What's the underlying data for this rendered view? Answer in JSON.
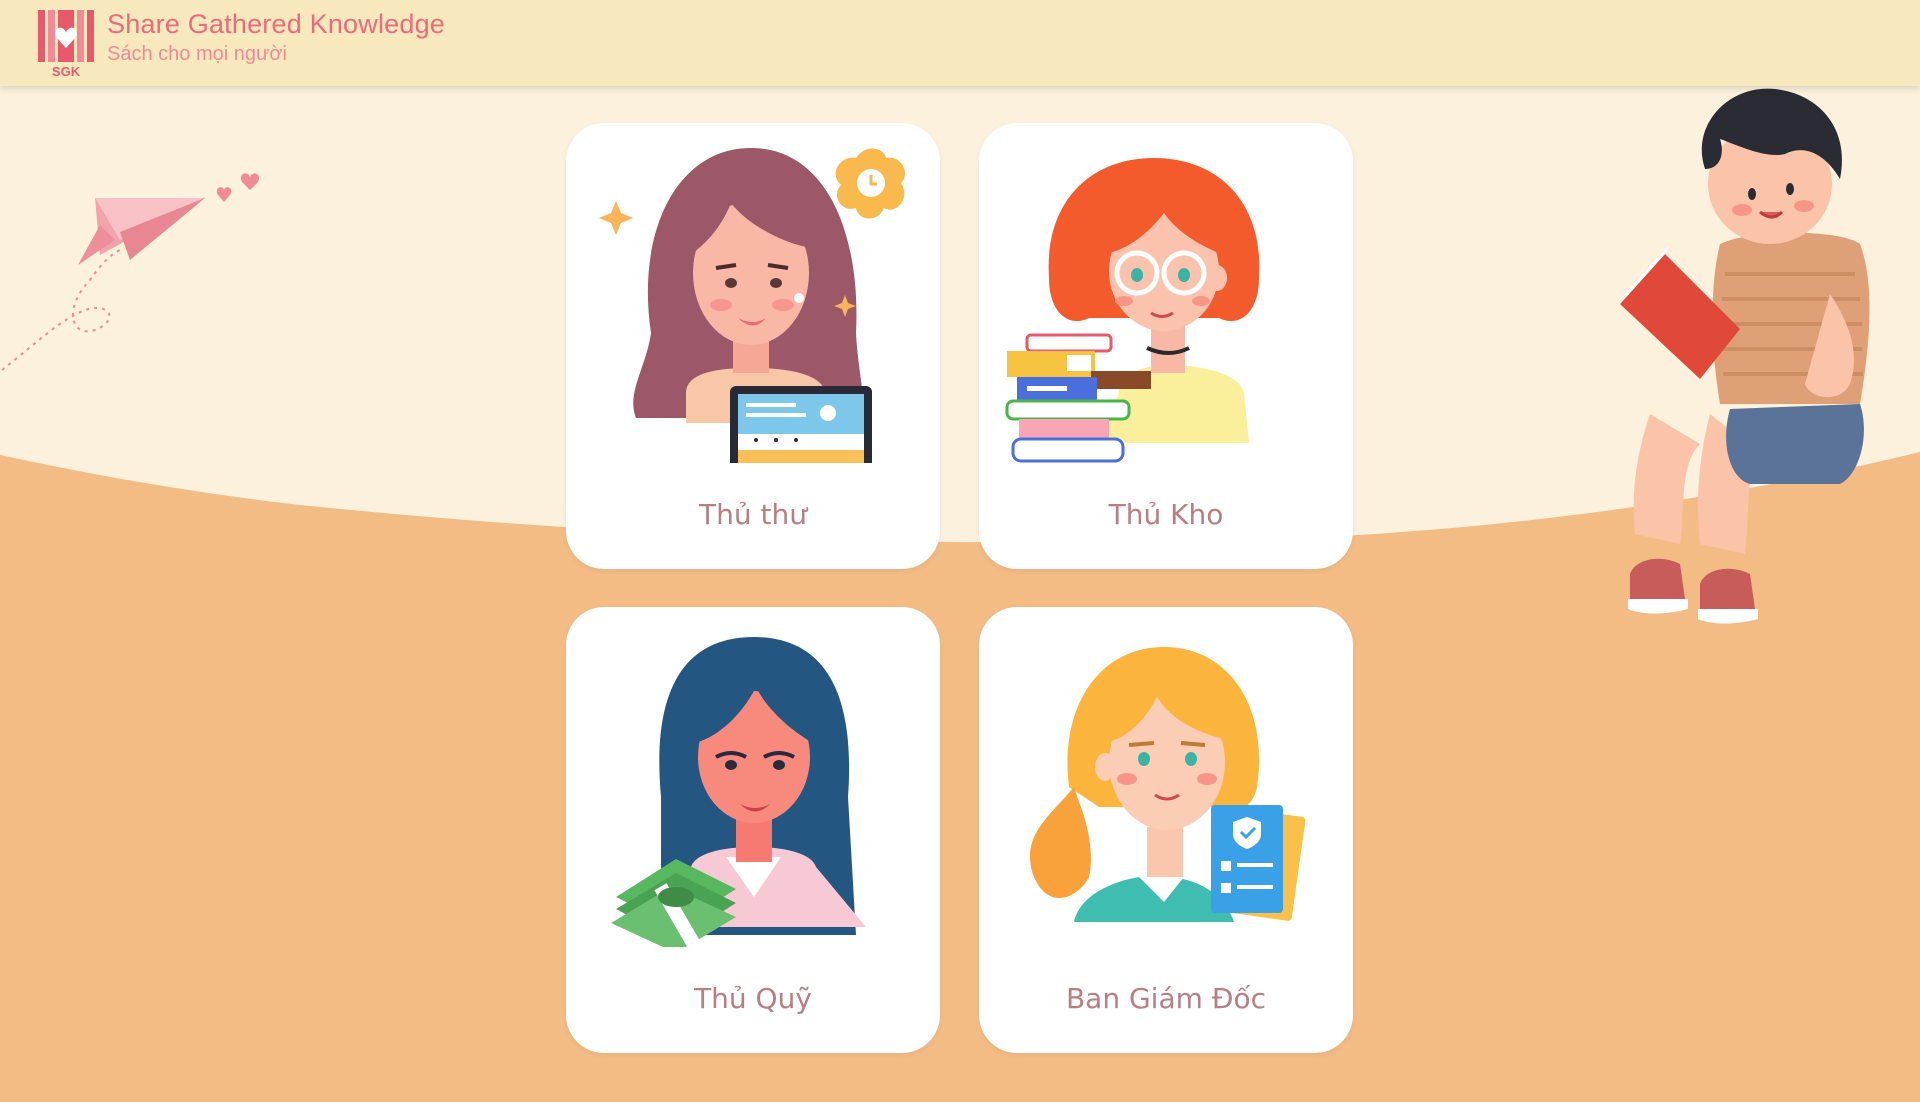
{
  "brand": {
    "logo_text": "SGK",
    "title": "Share Gathered Knowledge",
    "subtitle": "Sách cho mọi người"
  },
  "roles": [
    {
      "label": "Thủ thư"
    },
    {
      "label": "Thủ Kho"
    },
    {
      "label": "Thủ Quỹ"
    },
    {
      "label": "Ban Giám Đốc"
    }
  ],
  "colors": {
    "header_bg": "#f7e8bd",
    "page_top_bg": "#fbf1dc",
    "page_bottom_bg": "#f3bc85",
    "brand_pink": "#ec6b7a",
    "label_color": "#b87e83"
  }
}
